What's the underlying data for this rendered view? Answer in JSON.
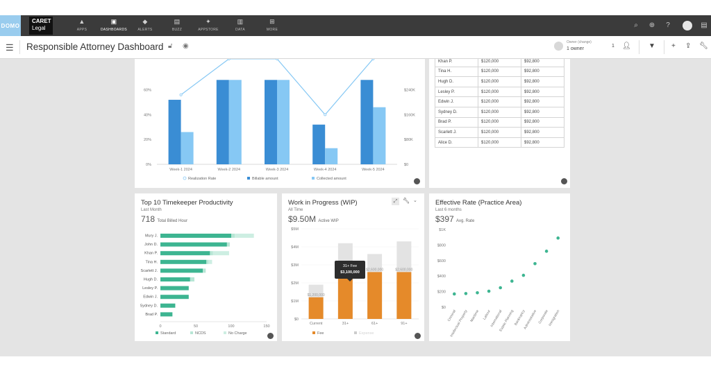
{
  "topnav": {
    "domo_logo": "DOMO",
    "brand_line1": "CARET",
    "brand_line2": "Legal",
    "items": [
      {
        "label": "APPS",
        "icon": "rocket-icon",
        "active": false
      },
      {
        "label": "DASHBOARDS",
        "icon": "dashboards-icon",
        "active": true
      },
      {
        "label": "ALERTS",
        "icon": "bell-icon",
        "active": false
      },
      {
        "label": "BUZZ",
        "icon": "chat-icon",
        "active": false
      },
      {
        "label": "APPSTORE",
        "icon": "appstore-icon",
        "active": false
      },
      {
        "label": "DATA",
        "icon": "database-icon",
        "active": false
      },
      {
        "label": "MORE",
        "icon": "grid-icon",
        "active": false
      }
    ]
  },
  "header": {
    "title": "Responsible Attorney Dashboard",
    "owner_label": "Owner (change)",
    "owner_value": "1 owner",
    "share_count": "1"
  },
  "realization_chart": {
    "chart_data": {
      "type": "bar",
      "categories": [
        "Week-1 2024",
        "Week-2 2024",
        "Week-3 2024",
        "Week-4 2024",
        "Week-5 2024"
      ],
      "series": [
        {
          "name": "Billable amount",
          "type": "bar",
          "values": [
            208000,
            272000,
            272000,
            128000,
            272000
          ],
          "color": "#3a8dd4"
        },
        {
          "name": "Collected amount",
          "type": "bar",
          "values": [
            104000,
            272000,
            272000,
            52000,
            184000
          ],
          "color": "#86c8f4"
        },
        {
          "name": "Realization Rate",
          "type": "line",
          "axis": "left",
          "values": [
            56,
            85,
            85,
            40,
            85
          ],
          "color": "#86c8f4"
        }
      ],
      "left_ticks": [
        "0%",
        "20%",
        "40%",
        "60%"
      ],
      "left_values": [
        0,
        20,
        40,
        60
      ],
      "right_ticks": [
        "$0",
        "$80K",
        "$160K",
        "$240K"
      ],
      "right_values": [
        0,
        80000,
        160000,
        240000
      ],
      "ylim_left": [
        0,
        70
      ],
      "ylim_right": [
        0,
        280000
      ],
      "legend_position": "bottom"
    }
  },
  "table": {
    "rows": [
      [
        "Khan P.",
        "$120,000",
        "$92,800"
      ],
      [
        "Tina H.",
        "$120,000",
        "$92,800"
      ],
      [
        "Hugh D.",
        "$120,000",
        "$92,800"
      ],
      [
        "Lesley P.",
        "$120,000",
        "$92,800"
      ],
      [
        "Edwin J.",
        "$120,000",
        "$92,800"
      ],
      [
        "Sydney D.",
        "$120,000",
        "$92,800"
      ],
      [
        "Brad P.",
        "$120,000",
        "$92,800"
      ],
      [
        "Scarlett J.",
        "$120,000",
        "$92,800"
      ],
      [
        "Alice D.",
        "$120,000",
        "$92,800"
      ]
    ]
  },
  "productivity": {
    "title": "Top 10 Timekeeper Productivity",
    "subtitle": "Last Month",
    "big_value": "718",
    "big_label": "Total Billed Hour",
    "chart_data": {
      "type": "bar",
      "orientation": "horizontal",
      "stacked": true,
      "categories": [
        "Mury J.",
        "John D.",
        "Khan P.",
        "Tina H.",
        "Scarlett J.",
        "Hugh D.",
        "Lesley P.",
        "Edwin J.",
        "Sydney D.",
        "Brad P."
      ],
      "series": [
        {
          "name": "Standard",
          "values": [
            100,
            94,
            70,
            65,
            60,
            42,
            40,
            40,
            21,
            17
          ],
          "color": "#3db591"
        },
        {
          "name": "NCDS",
          "values": [
            5,
            4,
            4,
            3,
            4,
            6,
            0,
            0,
            0,
            0
          ],
          "color": "#b7e6d5"
        },
        {
          "name": "No Charge",
          "values": [
            27,
            0,
            23,
            5,
            0,
            0,
            0,
            0,
            0,
            0
          ],
          "color": "#cdeee2"
        }
      ],
      "x_ticks": [
        "0",
        "50",
        "100",
        "150"
      ],
      "x_values": [
        0,
        50,
        100,
        150
      ],
      "xlim": [
        0,
        150
      ],
      "legend_position": "bottom"
    }
  },
  "wip": {
    "title": "Work in Progress (WIP)",
    "subtitle": "All Time",
    "big_value": "$9.50M",
    "big_label": "Active WIP",
    "tooltip_line1": "31+ Fee",
    "tooltip_line2": "$3,100,000",
    "chart_data": {
      "type": "bar",
      "categories": [
        "Current",
        "31+",
        "61+",
        "91+"
      ],
      "series": [
        {
          "name": "Fee",
          "values": [
            1200000,
            3100000,
            2600000,
            2600000
          ],
          "color": "#e58a2a"
        },
        {
          "name": "Expense",
          "values": [
            1900000,
            4200000,
            3600000,
            4300000
          ],
          "color": "#e3e3e3"
        }
      ],
      "data_labels": [
        "$1,200,000",
        "",
        "$2,600,000",
        "$2,600,000"
      ],
      "y_ticks": [
        "$0",
        "$1M",
        "$2M",
        "$3M",
        "$4M",
        "$5M"
      ],
      "y_values": [
        0,
        1000000,
        2000000,
        3000000,
        4000000,
        5000000
      ],
      "ylim": [
        0,
        5000000
      ],
      "legend_position": "bottom"
    }
  },
  "effective_rate": {
    "title": "Effective Rate (Practice Area)",
    "subtitle": "Last 6 months",
    "big_value": "$397",
    "big_label": "Avg. Rate",
    "chart_data": {
      "type": "scatter",
      "categories": [
        "Criminal",
        "Intellectual Property",
        "Maritime",
        "Labour",
        "International",
        "Estate Planning",
        "Bankruptcy",
        "Administrative",
        "Corporate",
        "Immigration"
      ],
      "values": [
        170,
        175,
        185,
        205,
        250,
        335,
        410,
        560,
        720,
        890
      ],
      "color": "#3db591",
      "y_ticks": [
        "$0",
        "$200",
        "$400",
        "$600",
        "$800",
        "$1K"
      ],
      "y_values": [
        0,
        200,
        400,
        600,
        800,
        1000
      ],
      "ylim": [
        0,
        1000
      ]
    }
  }
}
